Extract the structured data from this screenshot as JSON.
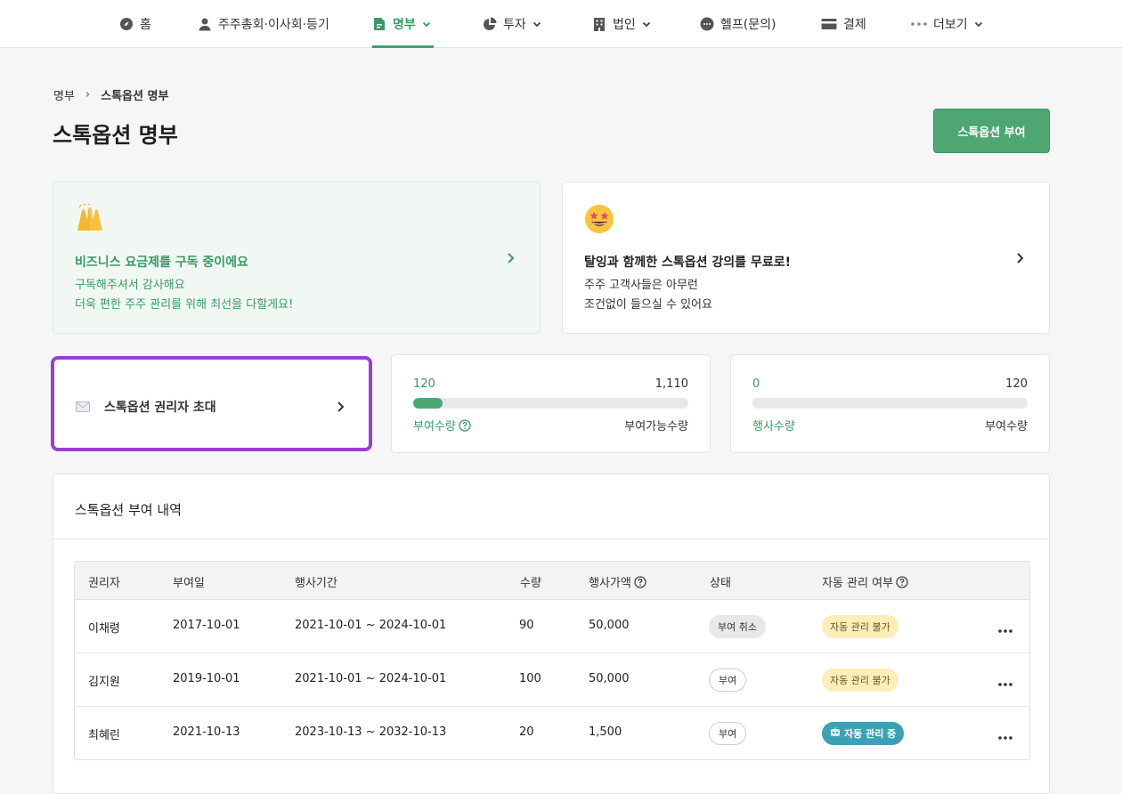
{
  "nav": {
    "items": [
      {
        "label": "홈",
        "icon": "compass-icon"
      },
      {
        "label": "주주총회·이사회·등기",
        "icon": "person-icon"
      },
      {
        "label": "명부",
        "icon": "document-icon",
        "active": true
      },
      {
        "label": "투자",
        "icon": "pie-chart-icon"
      },
      {
        "label": "법인",
        "icon": "building-icon"
      },
      {
        "label": "헬프(문의)",
        "icon": "chat-icon"
      },
      {
        "label": "결제",
        "icon": "card-icon"
      },
      {
        "label": "더보기",
        "icon": "more-dots-icon"
      }
    ]
  },
  "breadcrumb": {
    "parent": "명부",
    "separator": "›",
    "current": "스톡옵션 명부"
  },
  "page": {
    "title": "스톡옵션 명부",
    "grant_button": "스톡옵션 부여"
  },
  "promo_subscription": {
    "emoji": "🙌",
    "title": "비즈니스 요금제를 구독 중이에요",
    "line1": "구독해주셔서 감사해요",
    "line2": "더욱 편한 주주 관리를 위해 최선을 다할게요!"
  },
  "promo_lecture": {
    "emoji": "🤩",
    "title": "탈잉과 함께한 스톡옵션 강의를 무료로!",
    "line1": "주주 고객사들은 아무런",
    "line2": "조건없이 들으실 수 있어요"
  },
  "invite": {
    "label": "스톡옵션 권리자 초대"
  },
  "stats": {
    "granted": {
      "value": "120",
      "max": "1,110",
      "left_label": "부여수량",
      "right_label": "부여가능수량",
      "fill_fraction": 0.108
    },
    "exercised": {
      "value": "0",
      "max": "120",
      "left_label": "행사수량",
      "right_label": "부여수량",
      "fill_fraction": 0.0
    }
  },
  "history": {
    "title": "스톡옵션 부여 내역",
    "columns": [
      "권리자",
      "부여일",
      "행사기간",
      "수량",
      "행사가액",
      "상태",
      "자동 관리 여부"
    ],
    "rows": [
      {
        "holder": "이채령",
        "grant_date": "2017-10-01",
        "period": "2021-10-01 ~ 2024-10-01",
        "quantity": "90",
        "price": "50,000",
        "status": "부여 취소",
        "status_type": "cancel",
        "auto": "자동 관리 불가",
        "auto_type": "no"
      },
      {
        "holder": "김지원",
        "grant_date": "2019-10-01",
        "period": "2021-10-01 ~ 2024-10-01",
        "quantity": "100",
        "price": "50,000",
        "status": "부여",
        "status_type": "granted",
        "auto": "자동 관리 불가",
        "auto_type": "no"
      },
      {
        "holder": "최혜린",
        "grant_date": "2021-10-13",
        "period": "2023-10-13 ~ 2032-10-13",
        "quantity": "20",
        "price": "1,500",
        "status": "부여",
        "status_type": "granted",
        "auto": "자동 관리 중",
        "auto_type": "on"
      }
    ]
  },
  "colors": {
    "accent_green": "#4ea672",
    "highlight_purple": "#9a3fd0",
    "auto_on_teal": "#3ea0b4"
  }
}
